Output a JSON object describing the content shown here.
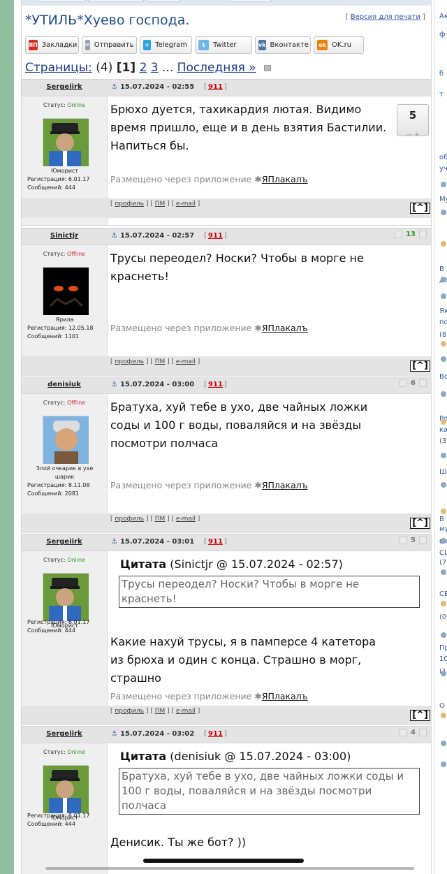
{
  "topic": {
    "title": "*УТИЛЬ*Хуево господа.",
    "print_link": "Версия для печати"
  },
  "share_buttons": [
    {
      "icon": "yandex-bookmarks-icon",
      "label": "Закладки",
      "icon_text": "ЯП",
      "color": "#d42b1e"
    },
    {
      "icon": "mail-send-icon",
      "label": "Отправить",
      "icon_text": "✉",
      "color": "#9aa0a6"
    },
    {
      "icon": "telegram-icon",
      "label": "Telegram",
      "icon_text": "✈",
      "color": "#2aa3df"
    },
    {
      "icon": "twitter-icon",
      "label": "Twitter",
      "icon_text": "t",
      "color": "#6fb7e6"
    },
    {
      "icon": "vkontakte-icon",
      "label": "Вконтакте",
      "icon_text": "vk",
      "color": "#4a76a8"
    },
    {
      "icon": "odnoklassniki-icon",
      "label": "OK.ru",
      "icon_text": "ok",
      "color": "#ee8208"
    }
  ],
  "pagination": {
    "label": "Страницы:",
    "total": "(4)",
    "current": "[1]",
    "pages": [
      "2",
      "3"
    ],
    "ellipsis": "...",
    "last": "Последняя »"
  },
  "common": {
    "status_label": "Статус:",
    "via_prefix": "Размещено через приложение",
    "via_app": "ЯПлакалъ",
    "link_profile": "профиль",
    "link_pm": "ПМ",
    "link_email": "e-mail",
    "to_top": "[^]",
    "quote_label": "Цитата"
  },
  "posts": [
    {
      "author": "Sergeiirk",
      "date": "15.07.2024 - 02:55",
      "post_number": "911",
      "status": "Online",
      "rank": "Юморист",
      "registration": "Регистрация: 6.01.17",
      "messages": "Сообщений: 444",
      "rating": "5",
      "rating_controls": "— +",
      "text": "Брюхо дуется, тахикардия лютая. Видимо время пришло, еще и в день взятия Бастилии. Напиться бы."
    },
    {
      "author": "Sinictjr",
      "date": "15.07.2024 - 02:57",
      "post_number": "911",
      "status": "Offline",
      "rank": "Ярила",
      "registration": "Регистрация: 12.05.18",
      "messages": "Сообщений: 1101",
      "rating": "13",
      "text": "Трусы переодел? Носки? Чтобы в морге не краснеть!"
    },
    {
      "author": "denisiuk",
      "date": "15.07.2024 - 03:00",
      "post_number": "911",
      "status": "Offline",
      "rank": "Злой очкарик в ухе шарик",
      "registration": "Регистрация: 8.11.08",
      "messages": "Сообщений: 2081",
      "rating": "6",
      "text": "Братуха, хуй тебе в ухо, две чайных ложки соды и 100 г воды, поваляйся и на звёзды посмотри полчаса"
    },
    {
      "author": "Sergeiirk",
      "date": "15.07.2024 - 03:01",
      "post_number": "911",
      "status": "Online",
      "rank": "Юморист",
      "registration": "Регистрация: 6.01.17",
      "messages": "Сообщений: 444",
      "rating": "5",
      "quote_source": "(Sinictjr @ 15.07.2024 - 02:57)",
      "quote_text": "Трусы переодел? Носки? Чтобы в морге не краснеть!",
      "text": "Какие нахуй трусы, я в памперсе 4 катетора из брюха и один с конца. Страшно в морг, страшно"
    },
    {
      "author": "Sergeiirk",
      "date": "15.07.2024 - 03:02",
      "post_number": "911",
      "status": "Online",
      "rank": "Юморист",
      "registration": "Регистрация: 6.01.17",
      "messages": "Сообщений: 444",
      "rating": "4",
      "quote_source": "(denisiuk @ 15.07.2024 - 03:00)",
      "quote_text": "Братуха, хуй тебе в ухо, две чайных ложки соды и 100 г воды, поваляйся и на звёзды посмотри полчаса",
      "text": "Денисик. Ты же бот? ))"
    }
  ],
  "right_sidebar": {
    "snippets": [
      "Ак",
      "ф",
      "б",
      "т",
      "об",
      "уч",
      "Му",
      "В",
      "де",
      "Як",
      "по",
      "(8",
      "Во",
      "Ро",
      "ка",
      "(3",
      "Ш",
      "В",
      "му",
      "Ст",
      "СЦ",
      "(7",
      "СЕ",
      "(0",
      "Пр",
      "10",
      "(1",
      "О"
    ]
  }
}
